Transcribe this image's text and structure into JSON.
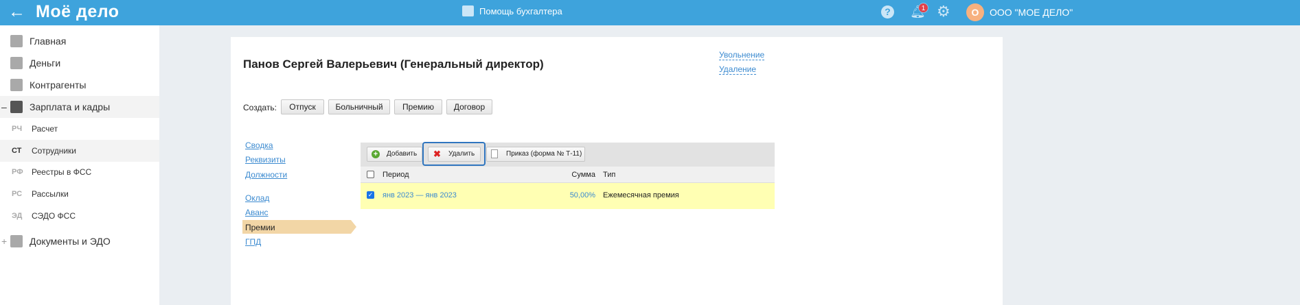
{
  "header": {
    "back_icon": "arrow-left",
    "logo": "Моё дело",
    "center_title": "Помощь бухгалтера",
    "notifications": "1",
    "avatar_letter": "О",
    "org_name": "ООО \"МОЕ ДЕЛО\""
  },
  "sidebar": {
    "items": [
      {
        "label": "Главная"
      },
      {
        "label": "Деньги"
      },
      {
        "label": "Контрагенты"
      },
      {
        "label": "Зарплата и кадры",
        "toggle": "–"
      }
    ],
    "subitems": [
      {
        "abbr": "РЧ",
        "label": "Расчет"
      },
      {
        "abbr": "СТ",
        "label": "Сотрудники"
      },
      {
        "abbr": "РФ",
        "label": "Реестры в ФСС"
      },
      {
        "abbr": "РС",
        "label": "Рассылки"
      },
      {
        "abbr": "ЭД",
        "label": "СЭДО ФСС"
      }
    ],
    "docs": {
      "label": "Документы и ЭДО",
      "toggle": "+"
    }
  },
  "employee": {
    "title": "Панов Сергей Валерьевич (Генеральный директор)",
    "dismiss": "Увольнение",
    "delete": "Удаление"
  },
  "create": {
    "label": "Создать:",
    "buttons": [
      "Отпуск",
      "Больничный",
      "Премию",
      "Договор"
    ]
  },
  "nav": {
    "group1": [
      "Сводка",
      "Реквизиты",
      "Должности"
    ],
    "group2": [
      "Оклад",
      "Аванс",
      "Премии",
      "ГПД"
    ],
    "selected": "Премии"
  },
  "grid": {
    "toolbar": {
      "add": "Добавить",
      "delete": "Удалить",
      "order": "Приказ (форма № Т-11)"
    },
    "columns": {
      "period": "Период",
      "sum": "Сумма",
      "type": "Тип"
    },
    "rows": [
      {
        "checked": true,
        "period": "янв 2023 — янв 2023",
        "sum": "50,00%",
        "type": "Ежемесячная премия"
      }
    ]
  }
}
